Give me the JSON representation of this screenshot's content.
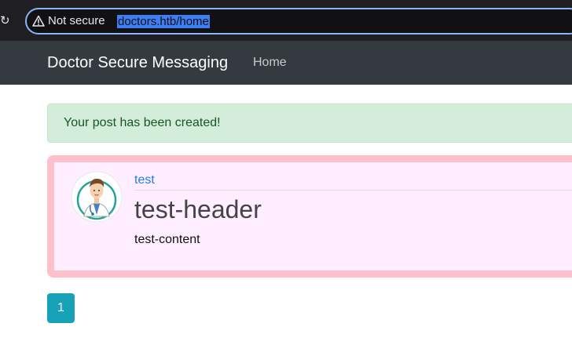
{
  "browser": {
    "security_label": "Not secure",
    "url": "doctors.htb/home"
  },
  "navbar": {
    "brand": "Doctor Secure Messaging",
    "links": [
      {
        "label": "Home"
      }
    ]
  },
  "alert": {
    "message": "Your post has been created!",
    "color": "#d4edda"
  },
  "post": {
    "author": "test",
    "title": "test-header",
    "content": "test-content",
    "border_color": "#ffc0cb",
    "background_color": "#ffeeff",
    "avatar_icon": "doctor-avatar-icon"
  },
  "pagination": {
    "pages": [
      "1"
    ],
    "active_color": "#17a2b8"
  }
}
